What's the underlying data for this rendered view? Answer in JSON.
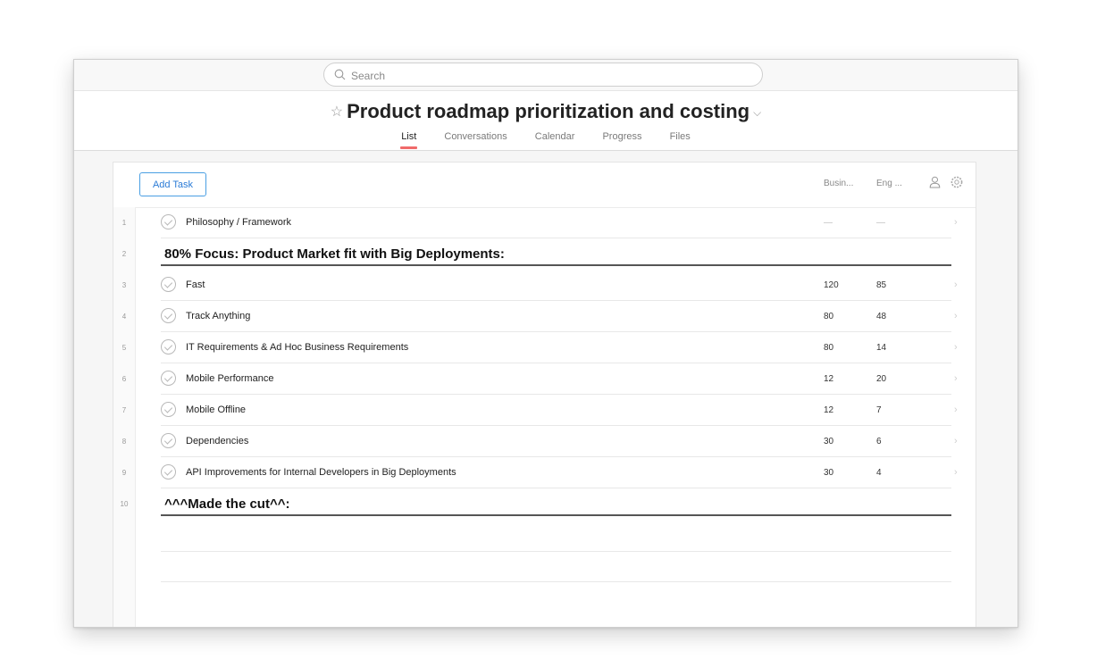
{
  "search": {
    "placeholder": "Search"
  },
  "project": {
    "title": "Product roadmap prioritization and costing"
  },
  "tabs": [
    {
      "label": "List",
      "active": true
    },
    {
      "label": "Conversations"
    },
    {
      "label": "Calendar"
    },
    {
      "label": "Progress"
    },
    {
      "label": "Files"
    }
  ],
  "toolbar": {
    "add_task_label": "Add Task",
    "column_business": "Busin...",
    "column_engineering": "Eng ..."
  },
  "rows": [
    {
      "num": "1",
      "type": "task",
      "name": "Philosophy / Framework",
      "business": "—",
      "engineering": "—"
    },
    {
      "num": "2",
      "type": "section",
      "name": "80% Focus: Product Market fit with Big Deployments:"
    },
    {
      "num": "3",
      "type": "task",
      "name": "Fast",
      "business": "120",
      "engineering": "85"
    },
    {
      "num": "4",
      "type": "task",
      "name": "Track Anything",
      "business": "80",
      "engineering": "48"
    },
    {
      "num": "5",
      "type": "task",
      "name": "IT Requirements & Ad Hoc Business Requirements",
      "business": "80",
      "engineering": "14"
    },
    {
      "num": "6",
      "type": "task",
      "name": "Mobile Performance",
      "business": "12",
      "engineering": "20"
    },
    {
      "num": "7",
      "type": "task",
      "name": "Mobile Offline",
      "business": "12",
      "engineering": "7"
    },
    {
      "num": "8",
      "type": "task",
      "name": "Dependencies",
      "business": "30",
      "engineering": "6"
    },
    {
      "num": "9",
      "type": "task",
      "name": "API Improvements for Internal Developers in Big Deployments",
      "business": "30",
      "engineering": "4"
    },
    {
      "num": "10",
      "type": "section",
      "name": "^^^Made the cut^^:"
    }
  ],
  "colors": {
    "accent": "#f06a6a",
    "button_blue": "#4a9fe3"
  }
}
